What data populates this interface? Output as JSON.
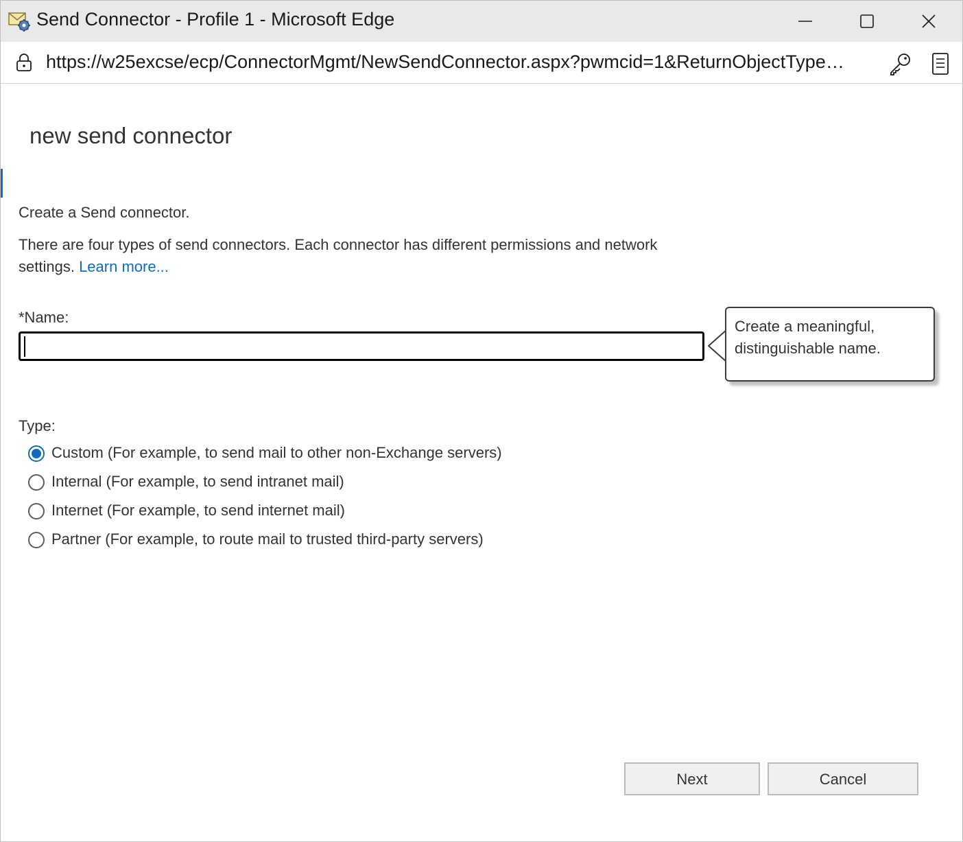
{
  "window": {
    "title": "Send Connector - Profile 1 - Microsoft Edge"
  },
  "addressbar": {
    "url": "https://w25excse/ecp/ConnectorMgmt/NewSendConnector.aspx?pwmcid=1&ReturnObjectType…"
  },
  "page": {
    "title": "new send connector",
    "intro": "Create a Send connector.",
    "description": "There are four types of send connectors. Each connector has different permissions and network settings.",
    "learn_more": "Learn more..."
  },
  "form": {
    "name_label": "*Name:",
    "name_value": "",
    "name_tooltip": "Create a meaningful, distinguishable name.",
    "type_label": "Type:",
    "type_options": [
      {
        "label": "Custom (For example, to send mail to other non-Exchange servers)",
        "checked": true
      },
      {
        "label": "Internal (For example, to send intranet mail)",
        "checked": false
      },
      {
        "label": "Internet (For example, to send internet mail)",
        "checked": false
      },
      {
        "label": "Partner (For example, to route mail to trusted third-party servers)",
        "checked": false
      }
    ]
  },
  "buttons": {
    "next": "Next",
    "cancel": "Cancel"
  },
  "colors": {
    "accent": "#0f6cbd",
    "titlebar": "#e9e9e9",
    "text": "#333333"
  }
}
